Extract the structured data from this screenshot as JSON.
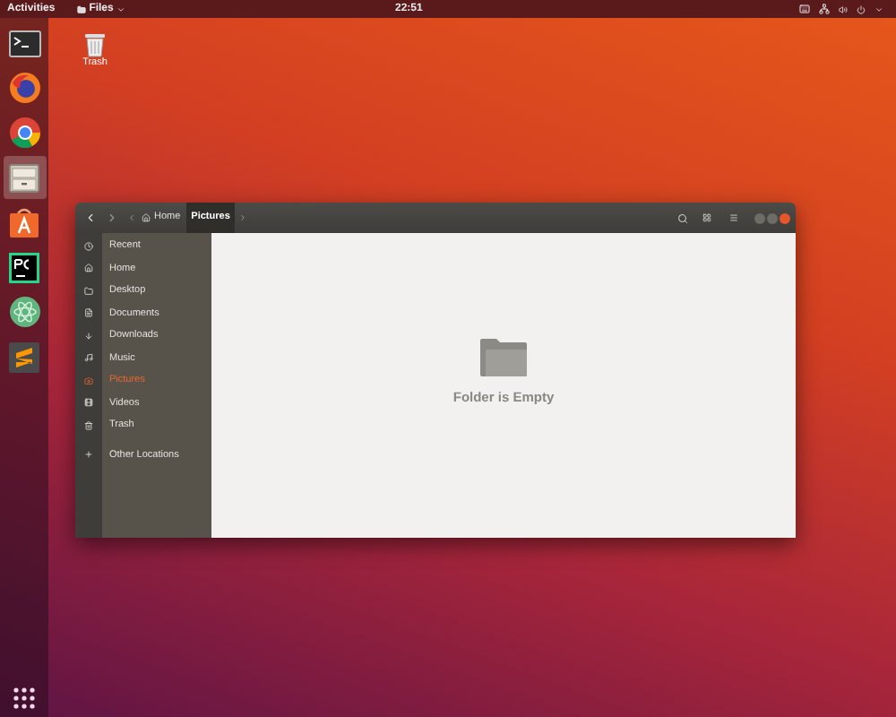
{
  "top_bar": {
    "activities": "Activities",
    "app_menu": "Files",
    "clock": "22:51"
  },
  "dock": {
    "items": [
      {
        "kind": "terminal",
        "selected": false
      },
      {
        "kind": "firefox",
        "selected": false
      },
      {
        "kind": "chrome",
        "selected": false
      },
      {
        "kind": "files",
        "selected": true
      },
      {
        "kind": "store",
        "selected": false
      },
      {
        "kind": "pycharm",
        "selected": false
      },
      {
        "kind": "atom",
        "selected": false
      },
      {
        "kind": "sublime",
        "selected": false
      }
    ]
  },
  "desktop_icons": [
    {
      "label": "Trash"
    }
  ],
  "window": {
    "path": [
      {
        "label": "Home",
        "kind": "home",
        "selected": false
      },
      {
        "label": "Pictures",
        "kind": "folder",
        "selected": true
      }
    ],
    "sidebar": {
      "items": [
        {
          "label": "Recent",
          "kind": "recent",
          "selected": false
        },
        {
          "label": "Home",
          "kind": "home",
          "selected": false
        },
        {
          "label": "Desktop",
          "kind": "desktop",
          "selected": false
        },
        {
          "label": "Documents",
          "kind": "documents",
          "selected": false
        },
        {
          "label": "Downloads",
          "kind": "downloads",
          "selected": false
        },
        {
          "label": "Music",
          "kind": "music",
          "selected": false
        },
        {
          "label": "Pictures",
          "kind": "pictures",
          "selected": true
        },
        {
          "label": "Videos",
          "kind": "videos",
          "selected": false
        },
        {
          "label": "Trash",
          "kind": "trash",
          "selected": false
        },
        {
          "label": "Other Locations",
          "kind": "other",
          "selected": false
        }
      ]
    },
    "empty_message": "Folder is Empty"
  }
}
